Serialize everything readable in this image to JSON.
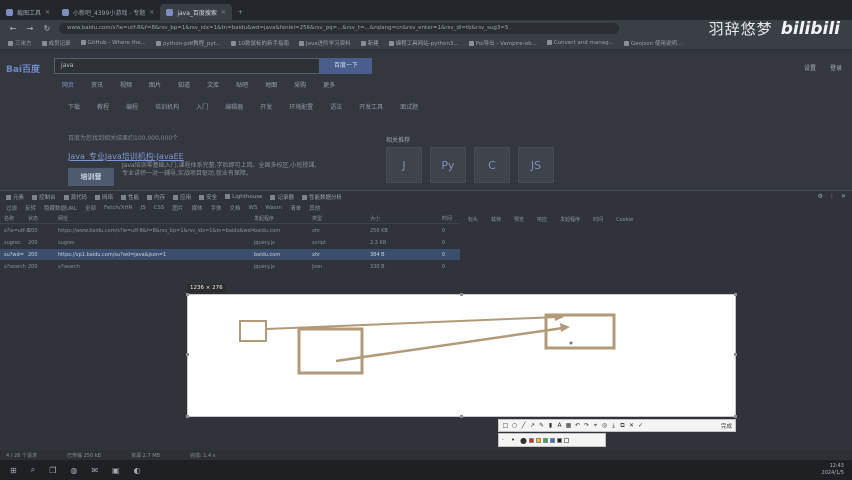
{
  "window": {
    "tabs": [
      {
        "label": "截图工具",
        "active": false
      },
      {
        "label": "小新吧_4399小游戏 - 专题",
        "active": false
      },
      {
        "label": "java_百度搜索",
        "active": true
      }
    ],
    "new_tab": "+",
    "nav": {
      "back": "←",
      "forward": "→",
      "reload": "↻"
    },
    "address": "www.baidu.com/s?ie=utf-8&f=8&rsv_bp=1&rsv_idx=1&tn=baidu&wd=java&fenlei=256&rsv_pq=...&rsv_t=...&rqlang=cn&rsv_enter=1&rsv_dl=tb&rsv_sug3=5"
  },
  "bookmarks": [
    "三米方",
    "成员记录",
    "GitHub - Where the...",
    "python-pdf教程_pyt...",
    "10款鼠标的新手指南",
    "Java进阶学习资料",
    "新建",
    "编程工具网站-python3...",
    "Poi导出 - Vampire-ob...",
    "Convert and manag...",
    "Geojson 使用说明..."
  ],
  "watermark": {
    "name": "羽辞悠梦",
    "logo": "bilibili"
  },
  "baidu": {
    "logo": "Bai百度",
    "query": "java",
    "search_button": "百度一下",
    "top_right": [
      "设置",
      "登录"
    ],
    "nav_tabs": [
      "网页",
      "资讯",
      "视频",
      "图片",
      "知道",
      "文库",
      "贴吧",
      "地图",
      "采购",
      "更多"
    ],
    "sub_tabs": [
      "下载",
      "教程",
      "编程",
      "培训机构",
      "入门",
      "编辑器",
      "开发",
      "环境配置",
      "语法",
      "开发工具",
      "面试题"
    ],
    "result_meta": "百度为您找到相关结果约100,000,000个",
    "result_title": "Java_专业Java培训机构-JavaEE",
    "result_badge": "培训营",
    "result_desc": "Java培训零基础入门,课程体系完整,学后即可上岗。全国多校区,小班授课,专业讲师一对一辅导,实战项目驱动,就业有保障。",
    "related_title": "相关推荐",
    "related_images": [
      "J",
      "Py",
      "C",
      "JS"
    ]
  },
  "devtools": {
    "toolbar_items": [
      "元素",
      "控制台",
      "源代码",
      "网络",
      "性能",
      "内存",
      "应用",
      "安全",
      "Lighthouse",
      "记录器",
      "性能数据分析"
    ],
    "filter_items": [
      "过滤",
      "反转",
      "隐藏数据URL",
      "全部",
      "Fetch/XHR",
      "JS",
      "CSS",
      "图片",
      "媒体",
      "字体",
      "文档",
      "WS",
      "Wasm",
      "清单",
      "其他"
    ],
    "columns": [
      "名称",
      "状态",
      "网址",
      "发起程序",
      "类型",
      "大小",
      "时间"
    ],
    "rows": [
      {
        "name": "s?ie=utf-8",
        "status": "200",
        "url": "https://www.baidu.com/s?ie=utf-8&f=8&rsv_bp=1&rsv_idx=1&tn=baidu&wd=java",
        "initiator": "baidu.com",
        "type": "xhr",
        "size": "250 KB",
        "time": "0",
        "selected": false
      },
      {
        "name": "sugrec",
        "status": "200",
        "url": "sugrec",
        "initiator": "jquery.js",
        "type": "script",
        "size": "2.3 KB",
        "time": "0",
        "selected": false
      },
      {
        "name": "su?wd=",
        "status": "200",
        "url": "https://sp1.baidu.com/su?wd=java&json=1",
        "initiator": "baidu.com",
        "type": "xhr",
        "size": "384 B",
        "time": "0",
        "selected": true
      },
      {
        "name": "s?search",
        "status": "200",
        "url": "s?search",
        "initiator": "jquery.js",
        "type": "json",
        "size": "330 B",
        "time": "0",
        "selected": false
      }
    ],
    "right_tabs": [
      "标头",
      "载荷",
      "预览",
      "响应",
      "发起程序",
      "时间",
      "Cookie"
    ],
    "side_icons": [
      "⚙",
      "⋮",
      "✕"
    ],
    "status": [
      "4 / 26 个请求",
      "已传输 250 kB",
      "资源 2.7 MB",
      "完成: 1.4 s"
    ]
  },
  "capture": {
    "size_label": "1236 × 276"
  },
  "snip_toolbar": {
    "tools": [
      "rect-tool",
      "ellipse-tool",
      "line-tool",
      "arrow-tool",
      "pen-tool",
      "marker-tool",
      "text-tool",
      "mosaic-tool",
      "undo-tool",
      "redo-tool",
      "pin-tool",
      "ocr-tool",
      "save-tool",
      "copy-tool",
      "cancel-tool",
      "ok-tool"
    ],
    "tool_glyphs": [
      "□",
      "○",
      "╱",
      "↗",
      "✎",
      "▮",
      "A",
      "▦",
      "↶",
      "↷",
      "⌖",
      "◎",
      "⤓",
      "⧉",
      "✕",
      "✓"
    ],
    "done_label": "完成",
    "colors": [
      "#e0251b",
      "#f6c224",
      "#2db34a",
      "#2d6ee0",
      "#222222",
      "#ffffff"
    ]
  },
  "taskbar": {
    "icons": [
      "⊞",
      "⌕",
      "❒",
      "◍",
      "✉",
      "▣",
      "◐"
    ],
    "time": "12:43",
    "date": "2024/1/5"
  }
}
